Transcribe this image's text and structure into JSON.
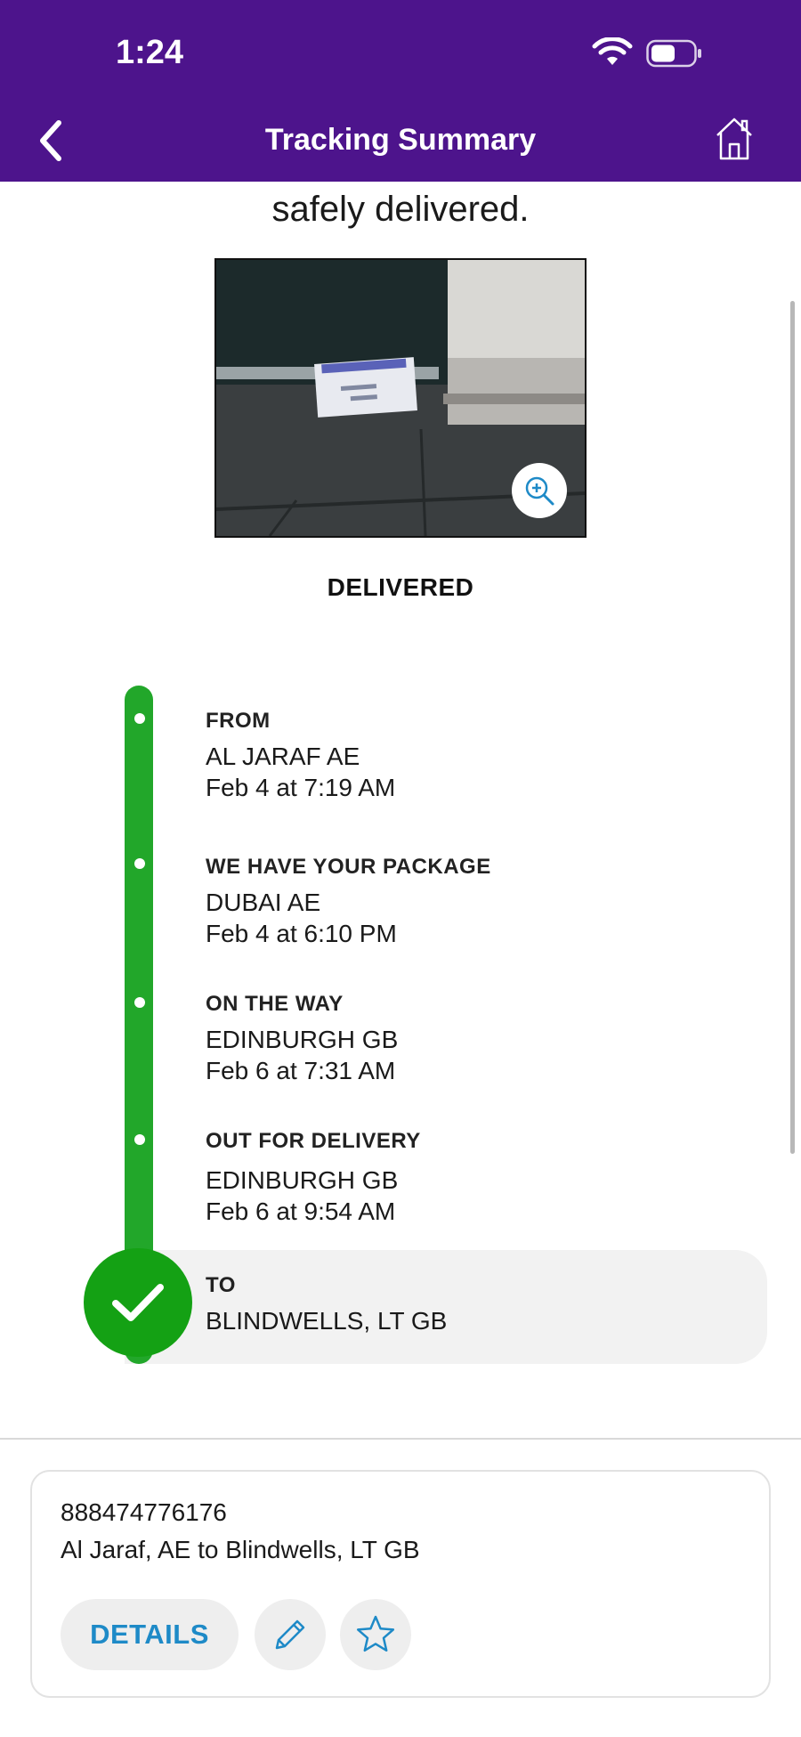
{
  "status_bar": {
    "time": "1:24"
  },
  "header": {
    "title": "Tracking Summary"
  },
  "delivery": {
    "message_line": "safely delivered.",
    "status": "DELIVERED"
  },
  "timeline": [
    {
      "title": "FROM",
      "location": "AL JARAF AE",
      "time": "Feb 4 at 7:19 AM"
    },
    {
      "title": "WE HAVE YOUR PACKAGE",
      "location": "DUBAI AE",
      "time": "Feb 4 at 6:10 PM"
    },
    {
      "title": "ON THE WAY",
      "location": "EDINBURGH GB",
      "time": "Feb 6 at 7:31 AM"
    },
    {
      "title": "OUT FOR DELIVERY",
      "location": "EDINBURGH GB",
      "time": "Feb 6 at 9:54 AM"
    }
  ],
  "destination": {
    "title": "TO",
    "location": "BLINDWELLS, LT  GB"
  },
  "card": {
    "tracking_number": "888474776176",
    "route": "Al Jaraf, AE to Blindwells, LT GB",
    "details_label": "DETAILS"
  },
  "colors": {
    "brand": "#4d148c",
    "progress": "#22a72a",
    "check": "#14a114",
    "link": "#1e8ac7"
  },
  "icons": [
    "back-arrow-icon",
    "home-icon",
    "wifi-icon",
    "battery-icon",
    "zoom-in-icon",
    "checkmark-icon",
    "pencil-icon",
    "star-icon"
  ]
}
